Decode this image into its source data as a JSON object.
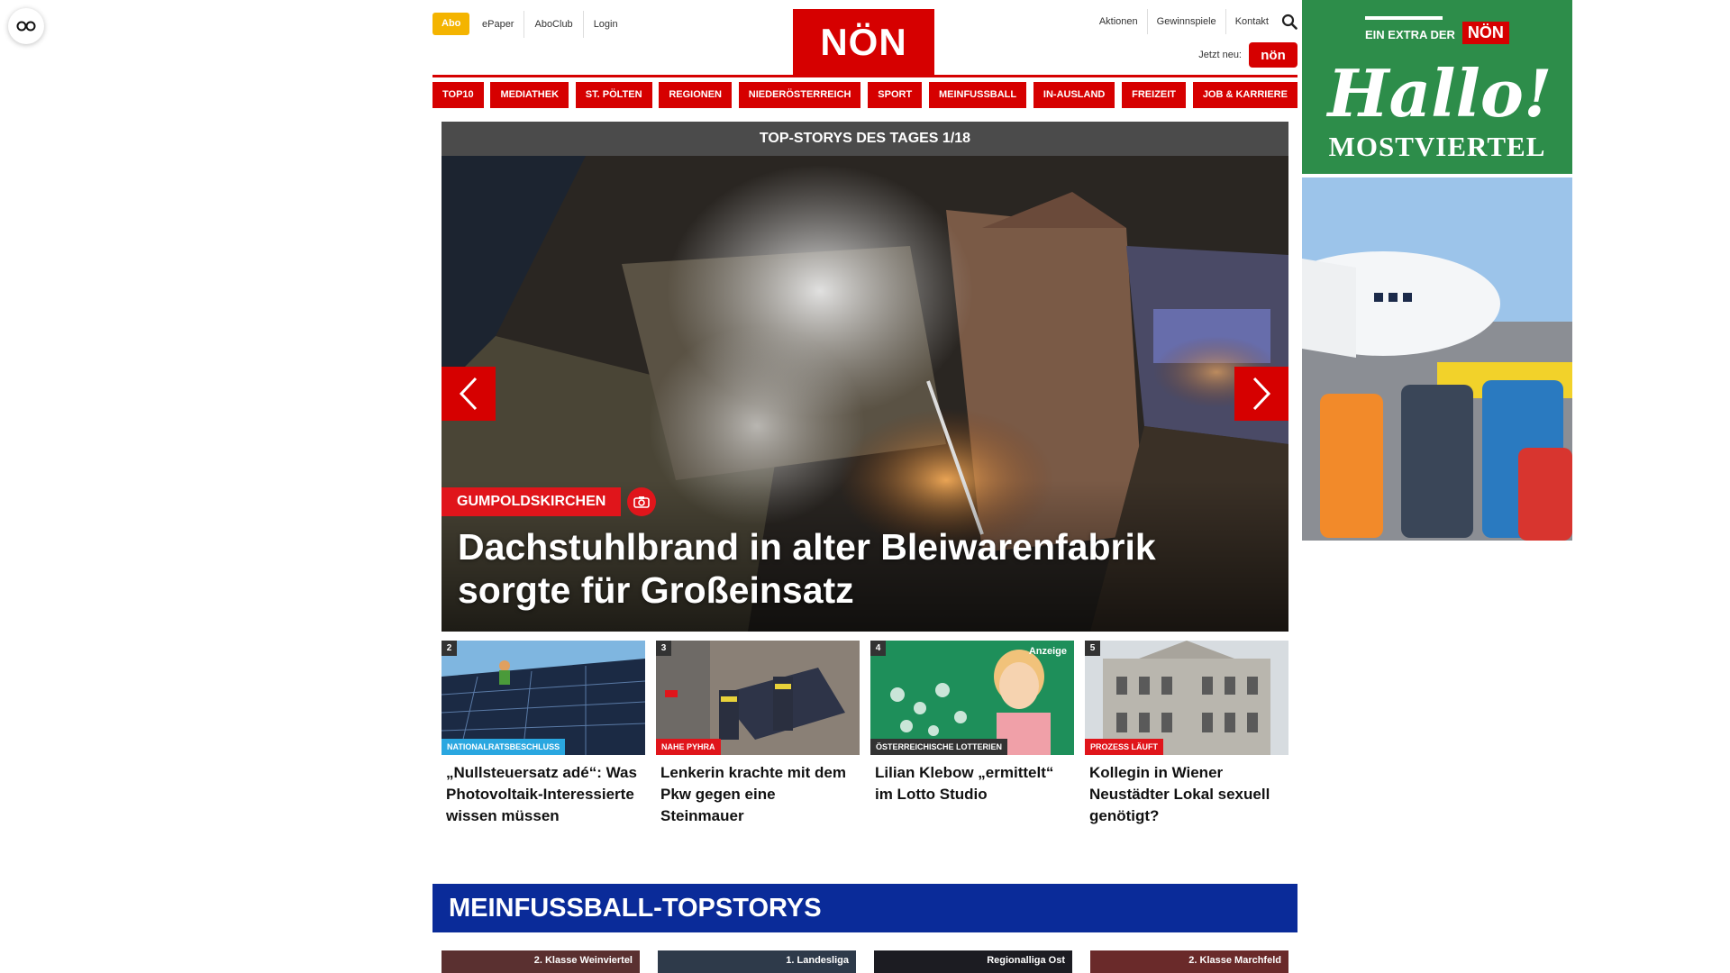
{
  "header": {
    "abo": "Abo",
    "top_links": [
      "ePaper",
      "AboClub",
      "Login"
    ],
    "logo": "NÖN",
    "right_links": [
      "Aktionen",
      "Gewinnspiele",
      "Kontakt"
    ],
    "jetzt_label": "Jetzt neu:",
    "jetzt_badge": "nön"
  },
  "nav": [
    "TOP10",
    "MEDIATHEK",
    "ST. PÖLTEN",
    "REGIONEN",
    "NIEDERÖSTERREICH",
    "SPORT",
    "MEINFUSSBALL",
    "IN-AUSLAND",
    "FREIZEIT",
    "JOB & KARRIERE"
  ],
  "hero": {
    "header": "TOP-STORYS DES TAGES 1/18",
    "tag": "GUMPOLDSKIRCHEN",
    "title": "Dachstuhlbrand in alter Bleiwarenfabrik sorgte für Großeinsatz"
  },
  "teasers": [
    {
      "num": "2",
      "tag": "NATIONALRATSBESCHLUSS",
      "tag_color": "#2aa7e0",
      "title": "„Nullsteuersatz adé“: Was Photovoltaik-Interessierte wissen müssen",
      "anzeige": ""
    },
    {
      "num": "3",
      "tag": "NAHE PYHRA",
      "tag_color": "#e0151b",
      "title": "Lenkerin krachte mit dem Pkw gegen eine Steinmauer",
      "anzeige": ""
    },
    {
      "num": "4",
      "tag": "ÖSTERREICHISCHE LOTTERIEN",
      "tag_color": "#333333",
      "title": "Lilian Klebow „ermittelt“ im Lotto Studio",
      "anzeige": "Anzeige"
    },
    {
      "num": "5",
      "tag": "PROZESS LÄUFT",
      "tag_color": "#e0151b",
      "title": "Kollegin in Wiener Neustädter Lokal sexuell genötigt?",
      "anzeige": ""
    }
  ],
  "meinfussball": {
    "title": "MEINFUSSBALL-TOPSTORYS",
    "cards": [
      "2. Klasse Weinviertel",
      "1. Landesliga",
      "Regionalliga Ost",
      "2. Klasse Marchfeld"
    ]
  },
  "ads": {
    "extra": "EIN EXTRA DER",
    "logo": "NÖN",
    "hallo": "Hallo!",
    "region": "MOSTVIERTEL"
  },
  "colors": {
    "brand_red": "#d60000",
    "abo_yellow": "#f4b400",
    "meinfussball_blue": "#0a2b99",
    "ad_green": "#2d8d4a"
  }
}
